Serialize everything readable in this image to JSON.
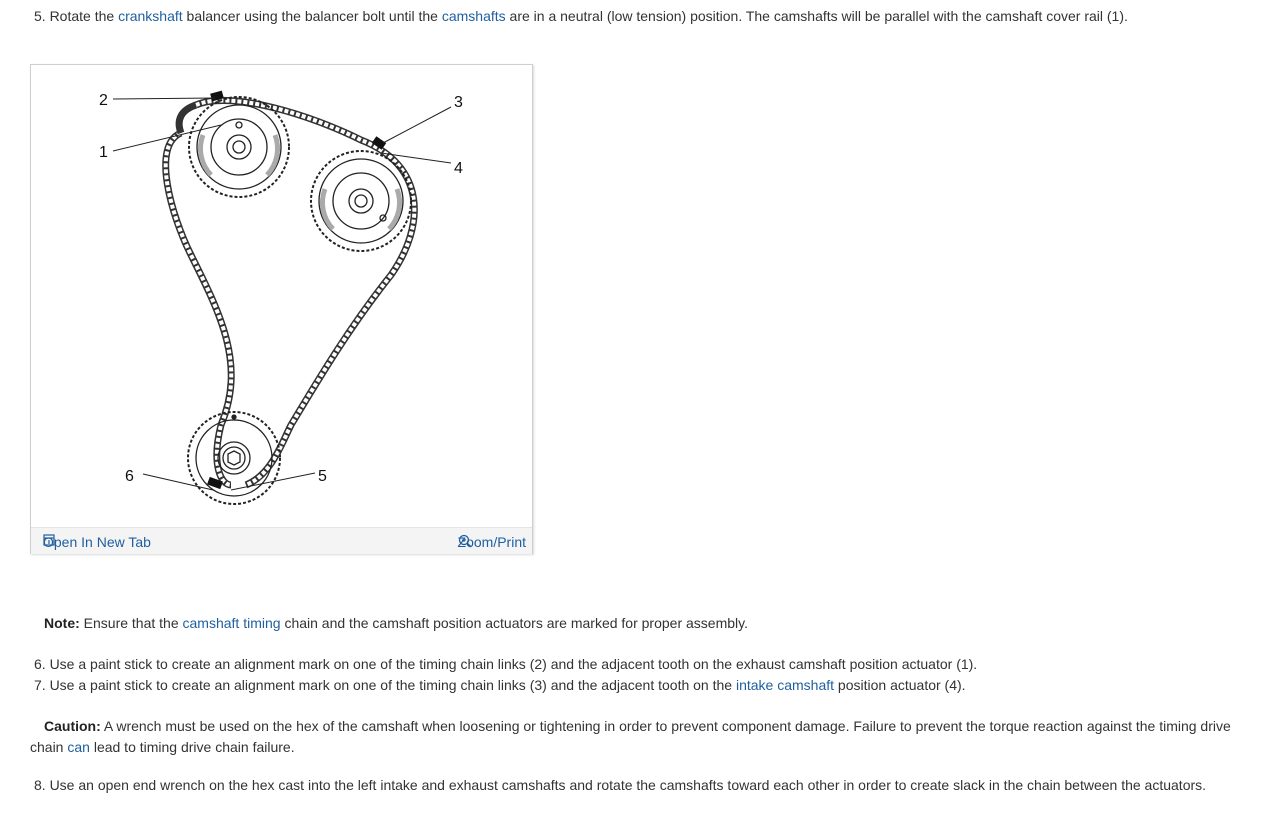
{
  "step5": {
    "prefix": "5. Rotate the ",
    "link1": "crankshaft",
    "mid": " balancer using the balancer bolt until the ",
    "link2": "camshafts",
    "suffix": " are in a neutral (low tension) position. The camshafts will be parallel with the camshaft cover rail (1)."
  },
  "figure": {
    "callouts": {
      "c1": "1",
      "c2": "2",
      "c3": "3",
      "c4": "4",
      "c5": "5",
      "c6": "6"
    },
    "open_tab_label": "Open In New Tab",
    "zoom_label": "Zoom/Print"
  },
  "note": {
    "label": "Note:",
    "prefix": " Ensure that the ",
    "link": "camshaft timing",
    "suffix": " chain and the camshaft position actuators are marked for proper assembly."
  },
  "step6": {
    "text": "6. Use a paint stick to create an alignment mark on one of the timing chain links (2) and the adjacent tooth on the exhaust camshaft position actuator (1)."
  },
  "step7": {
    "prefix": "7. Use a paint stick to create an alignment mark on one of the timing chain links (3) and the adjacent tooth on the ",
    "link": "intake camshaft",
    "suffix": " position actuator (4)."
  },
  "caution": {
    "label": "Caution:",
    "text1": " A wrench must be used on the hex of the camshaft when loosening or tightening in order to prevent component damage. Failure to prevent the torque reaction against the timing drive chain ",
    "link": "can",
    "text2": " lead to timing drive chain failure."
  },
  "step8": {
    "text": "8. Use an open end wrench on the hex cast into the left intake and exhaust camshafts and rotate the camshafts toward each other in order to create slack in the chain between the actuators."
  }
}
